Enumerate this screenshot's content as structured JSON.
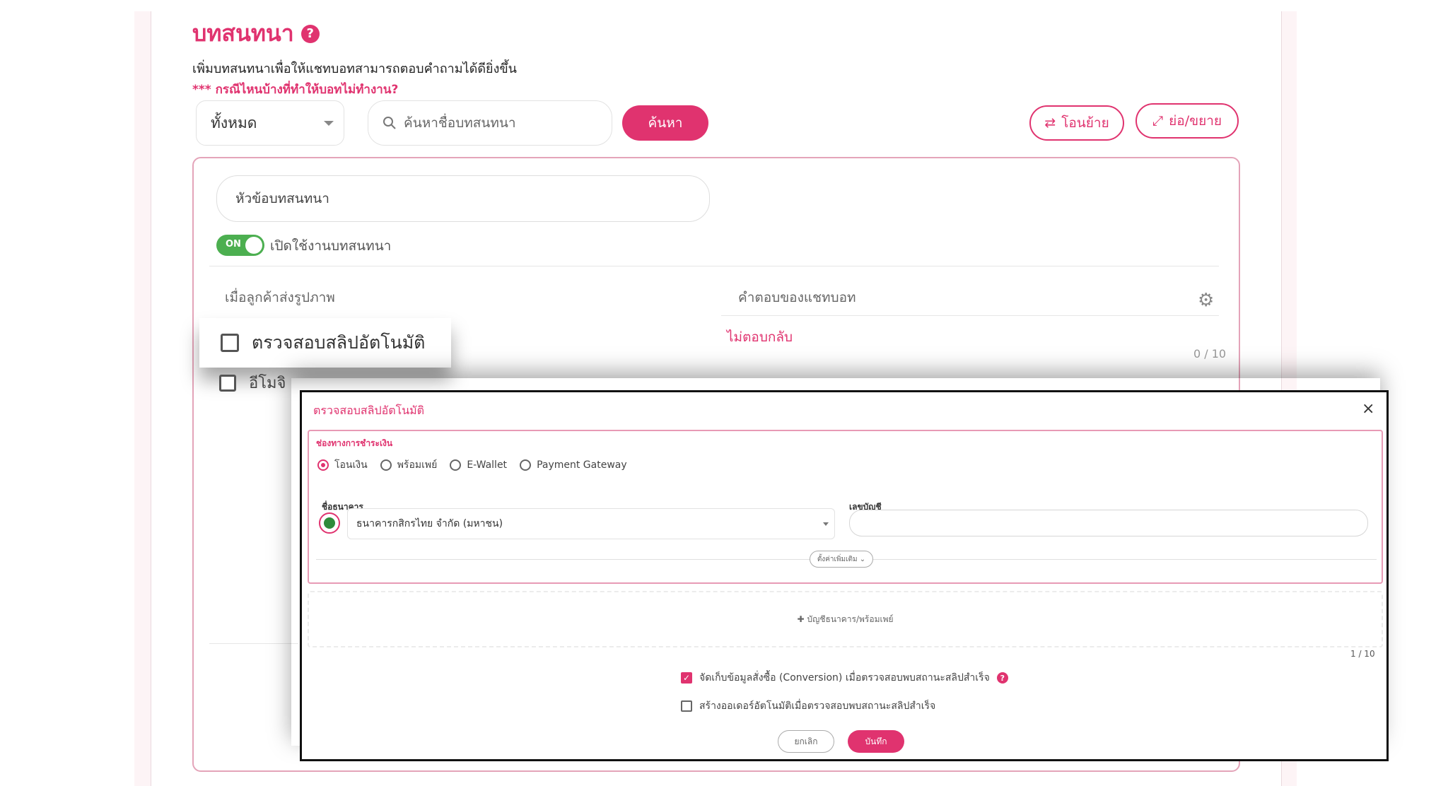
{
  "header": {
    "title": "บทสนทนา",
    "help_icon": "?",
    "subtitle": "เพิ่มบทสนทนาเพื่อให้แชทบอทสามารถตอบคำถามได้ดียิ่งขึ้น",
    "why_link": "*** กรณีไหนบ้างที่ทำให้บอทไม่ทำงาน?"
  },
  "toolbar": {
    "filter_value": "ทั้งหมด",
    "search_placeholder": "ค้นหาชื่อบทสนทนา",
    "search_button": "ค้นหา",
    "move_button": "โอนย้าย",
    "resize_button": "ย่อ/ขยาย"
  },
  "conversation": {
    "topic_placeholder": "หัวข้อบทสนทนา",
    "toggle_state": "ON",
    "toggle_label": "เปิดใช้งานบทสนทนา",
    "trigger_header": "เมื่อลูกค้าส่งรูปภาพ",
    "response_header": "คำตอบของแชทบอท",
    "no_reply": "ไม่ตอบกลับ",
    "counter": "0 / 10",
    "slip_check_label": "ตรวจสอบสลิปอัตโนมัติ",
    "emoji_label": "อีโมจิ"
  },
  "dialog": {
    "title": "ตรวจสอบสลิปอัตโนมัติ",
    "close": "×",
    "payment_label": "ช่องทางการชำระเงิน",
    "payment_options": [
      "โอนเงิน",
      "พร้อมเพย์",
      "E-Wallet",
      "Payment Gateway"
    ],
    "selected_payment": "โอนเงิน",
    "bank_label": "ชื่อธนาคาร",
    "bank_value": "ธนาคารกสิกรไทย จำกัด (มหาชน)",
    "account_label": "เลขบัญชี",
    "account_value": "",
    "more_settings": "ตั้งค่าเพิ่มเติม ⌄",
    "add_account": "บัญชีธนาคาร/พร้อมเพย์",
    "counter": "1 / 10",
    "option_conversion": "จัดเก็บข้อมูลสั่งซื้อ (Conversion) เมื่อตรวจสอบพบสถานะสลิปสำเร็จ",
    "option_conversion_checked": true,
    "option_auto_order": "สร้างออเดอร์อัตโนมัติเมื่อตรวจสอบพบสถานะสลิปสำเร็จ",
    "option_auto_order_checked": false,
    "cancel_button": "ยกเลิก",
    "save_button": "บันทึก"
  },
  "colors": {
    "accent": "#e0336f",
    "toggle_on": "#4caf50",
    "bank_brand": "#2e8b3a"
  },
  "icons": [
    "help-icon",
    "search-icon",
    "chevron-down-icon",
    "swap-icon",
    "expand-icon",
    "gear-icon",
    "close-icon",
    "plus-icon",
    "checkbox-icon",
    "radio-icon",
    "bank-logo-icon"
  ]
}
